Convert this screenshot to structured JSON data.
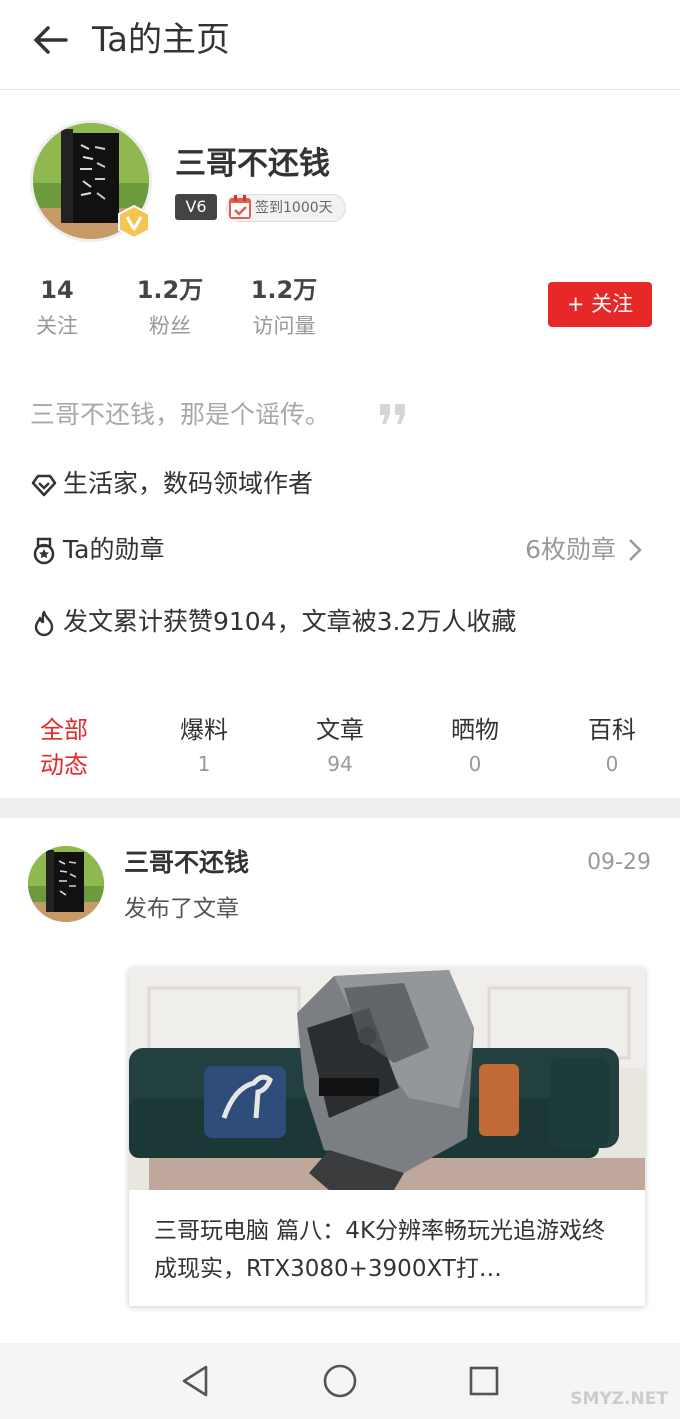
{
  "header": {
    "title": "Ta的主页"
  },
  "profile": {
    "name": "三哥不还钱",
    "level": "V6",
    "signin_badge": "签到1000天",
    "stats": [
      {
        "num": "14",
        "label": "关注"
      },
      {
        "num": "1.2万",
        "label": "粉丝"
      },
      {
        "num": "1.2万",
        "label": "访问量"
      }
    ],
    "follow_label": "+ 关注",
    "motto": "三哥不还钱，那是个谣传。",
    "role": "生活家，数码领域作者",
    "medals_label": "Ta的勋章",
    "medals_count": "6枚勋章",
    "likes_text": "发文累计获赞9104，文章被3.2万人收藏"
  },
  "tabs": {
    "active": {
      "line1": "全部",
      "line2": "动态"
    },
    "items": [
      {
        "label": "爆料",
        "count": "1"
      },
      {
        "label": "文章",
        "count": "94"
      },
      {
        "label": "晒物",
        "count": "0"
      },
      {
        "label": "百科",
        "count": "0"
      }
    ]
  },
  "feed": {
    "name": "三哥不还钱",
    "date": "09-29",
    "action": "发布了文章",
    "card_title": "三哥玩电脑 篇八：4K分辨率畅玩光追游戏终成现实，RTX3080+3900XT打…"
  },
  "watermark": "SMYZ.NET",
  "colors": {
    "accent": "#e62828",
    "muted": "#999999",
    "text": "#333333"
  }
}
